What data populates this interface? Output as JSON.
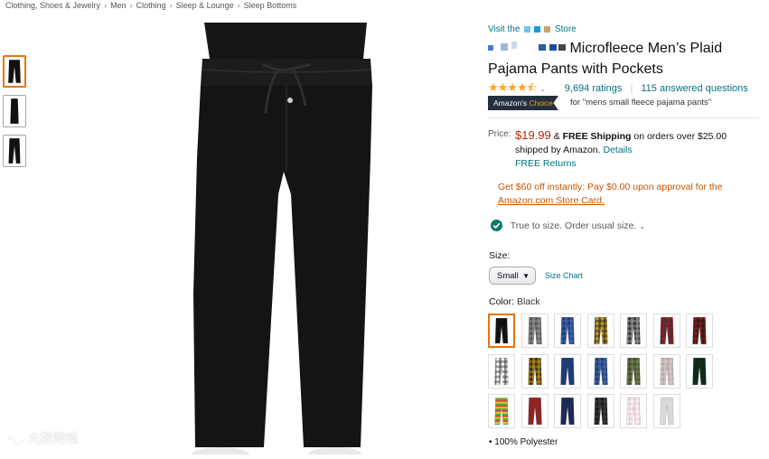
{
  "breadcrumb": [
    "Clothing, Shoes & Jewelry",
    "Men",
    "Clothing",
    "Sleep & Lounge",
    "Sleep Bottoms"
  ],
  "breadcrumb_sep": "›",
  "store": {
    "prefix": "Visit the",
    "suffix": "Store"
  },
  "title": {
    "visible": "Microfleece Men’s Plaid Pajama Pants with Pockets"
  },
  "rating": {
    "stars": "★★★★⯪",
    "count": "9,694 ratings",
    "separator": "|",
    "questions": "115 answered questions"
  },
  "badge": {
    "amazons": "Amazon's",
    "choice": "Choice",
    "for_text": "for \"mens small fleece pajama pants\""
  },
  "price": {
    "label": "Price:",
    "value": "$19.99",
    "amp": "&",
    "free_shipping": "FREE Shipping",
    "rest": "on orders over $25.00 shipped by Amazon.",
    "details": "Details",
    "free_returns": "FREE Returns"
  },
  "promo": {
    "line1": "Get $60 off instantly: Pay $0.00 upon approval for the",
    "card": "Amazon.com Store Card."
  },
  "fit": {
    "text": "True to size. Order usual size.",
    "chevron": "⌄"
  },
  "size": {
    "label": "Size:",
    "selected": "Small",
    "chart": "Size Chart"
  },
  "color": {
    "label": "Color:",
    "selected": "Black"
  },
  "swatches": [
    {
      "pattern": "solid",
      "colors": [
        "#111111"
      ]
    },
    {
      "pattern": "plaid",
      "colors": [
        "#555555",
        "#999999"
      ]
    },
    {
      "pattern": "plaid",
      "colors": [
        "#1e3a7a",
        "#4a6db3"
      ]
    },
    {
      "pattern": "plaid",
      "colors": [
        "#c8a020",
        "#222222"
      ]
    },
    {
      "pattern": "plaid",
      "colors": [
        "#333333",
        "#aaaaaa"
      ]
    },
    {
      "pattern": "plaid",
      "colors": [
        "#9b1b25",
        "#333333"
      ]
    },
    {
      "pattern": "plaid",
      "colors": [
        "#8b1a1a",
        "#1a1a1a"
      ]
    },
    {
      "pattern": "plaid",
      "colors": [
        "#ffffff",
        "#333333"
      ]
    },
    {
      "pattern": "plaid",
      "colors": [
        "#2a2a2a",
        "#d9a000"
      ]
    },
    {
      "pattern": "solid",
      "colors": [
        "#1f3b73"
      ]
    },
    {
      "pattern": "plaid",
      "colors": [
        "#1f3b73",
        "#4b6fae"
      ]
    },
    {
      "pattern": "plaid",
      "colors": [
        "#3b4a2a",
        "#7a8a55"
      ]
    },
    {
      "pattern": "plaid",
      "colors": [
        "#b9a9a9",
        "#ddd0d0"
      ]
    },
    {
      "pattern": "solid",
      "colors": [
        "#0f2a18"
      ]
    },
    {
      "pattern": "stripes",
      "colors": [
        "#e03a2a",
        "#f1c40f",
        "#2eae4f"
      ]
    },
    {
      "pattern": "solid",
      "colors": [
        "#8e2424"
      ]
    },
    {
      "pattern": "solid",
      "colors": [
        "#1c2b55"
      ]
    },
    {
      "pattern": "plaid",
      "colors": [
        "#1a1a1a",
        "#444444"
      ]
    },
    {
      "pattern": "plaid",
      "colors": [
        "#e6c9d2",
        "#ffffff"
      ]
    },
    {
      "pattern": "solid",
      "colors": [
        "#d9d9d9"
      ]
    }
  ],
  "bullets": [
    "100% Polyester"
  ],
  "watermark": "大数跨境",
  "colors": {
    "link": "#007185",
    "price": "#b12704",
    "promo": "#c45500",
    "badge_bg": "#232f3e",
    "badge_accent": "#ff9900",
    "selected_border": "#e77600",
    "check": "#067d62"
  }
}
